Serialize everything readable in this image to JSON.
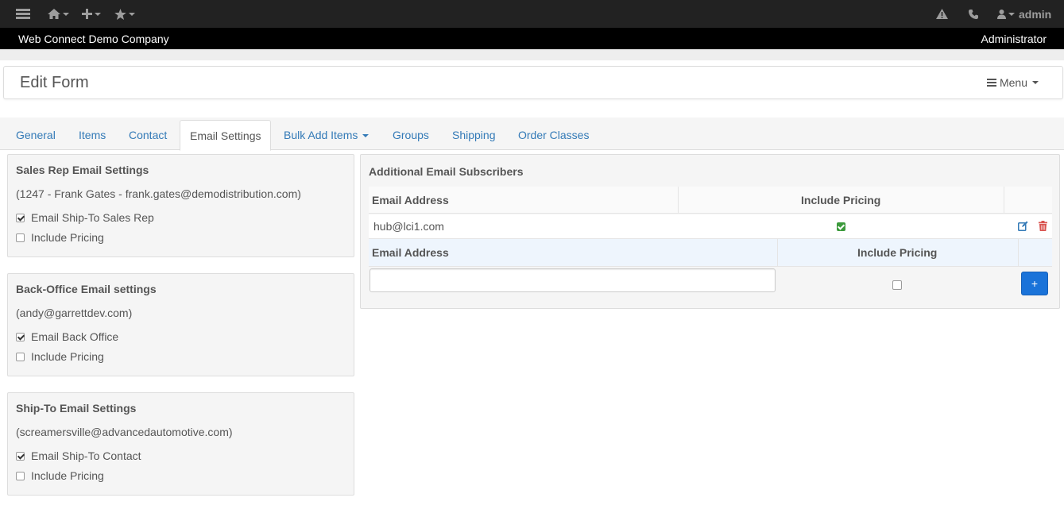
{
  "topbar": {
    "user_label": "admin",
    "icons": [
      "hamburger-icon",
      "home-icon",
      "plus-icon",
      "star-icon",
      "warning-icon",
      "phone-icon",
      "user-icon"
    ]
  },
  "company": {
    "name": "Web Connect Demo Company",
    "role": "Administrator"
  },
  "page": {
    "title": "Edit Form",
    "menu_label": "Menu"
  },
  "tabs": [
    {
      "label": "General"
    },
    {
      "label": "Items"
    },
    {
      "label": "Contact"
    },
    {
      "label": "Email Settings",
      "active": true
    },
    {
      "label": "Bulk Add Items"
    },
    {
      "label": "Groups"
    },
    {
      "label": "Shipping"
    },
    {
      "label": "Order Classes"
    }
  ],
  "panels": [
    {
      "title": "Sales Rep Email Settings",
      "email": "(1247 - Frank Gates - frank.gates@demodistribution.com)",
      "option1": {
        "label": "Email Ship-To Sales Rep",
        "checked": true
      },
      "option2": {
        "label": "Include Pricing",
        "checked": false
      }
    },
    {
      "title": "Back-Office Email settings",
      "email": "(andy@garrettdev.com)",
      "option1": {
        "label": "Email Back Office",
        "checked": true
      },
      "option2": {
        "label": "Include Pricing",
        "checked": false
      }
    },
    {
      "title": "Ship-To Email Settings",
      "email": "(screamersville@advancedautomotive.com)",
      "option1": {
        "label": "Email Ship-To Contact",
        "checked": true
      },
      "option2": {
        "label": "Include Pricing",
        "checked": false
      }
    }
  ],
  "subscribers": {
    "title": "Additional Email Subscribers",
    "col_email": "Email Address",
    "col_pricing": "Include Pricing",
    "rows": [
      {
        "email": "hub@lci1.com",
        "include_pricing": true
      }
    ],
    "new_row": {
      "col_email": "Email Address",
      "col_pricing": "Include Pricing",
      "email_value": "",
      "include_pricing": false,
      "add_label": "+"
    }
  },
  "colors": {
    "link": "#337ab7",
    "topbar": "#222222",
    "add_button": "#1a73d9",
    "delete_icon": "#d9534f",
    "check_green": "#3c9a3c"
  }
}
